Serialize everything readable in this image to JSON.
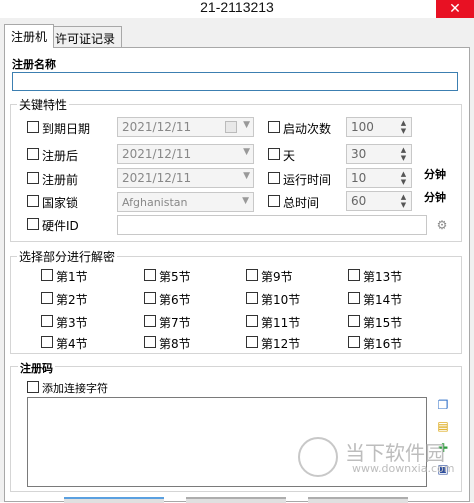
{
  "window": {
    "title": "21-2113213",
    "close_glyph": "✕"
  },
  "tabs": [
    {
      "label": "注册机",
      "active": true
    },
    {
      "label": "许可证记录",
      "active": false
    }
  ],
  "reg_name": {
    "label": "注册名称",
    "value": ""
  },
  "key_props": {
    "title": "关键特性",
    "expire_date": {
      "label": "到期日期",
      "value": "2021/12/11",
      "checked": false
    },
    "after_reg": {
      "label": "注册后",
      "value": "2021/12/11",
      "checked": false
    },
    "before_reg": {
      "label": "注册前",
      "value": "2021/12/11",
      "checked": false
    },
    "country_lock": {
      "label": "国家锁",
      "value": "Afghanistan",
      "checked": false
    },
    "hardware_id": {
      "label": "硬件ID",
      "value": "",
      "checked": false
    },
    "launch_count": {
      "label": "启动次数",
      "value": "100",
      "checked": false
    },
    "days": {
      "label": "天",
      "value": "30",
      "checked": false
    },
    "run_time": {
      "label": "运行时间",
      "value": "10",
      "unit": "分钟",
      "checked": false
    },
    "total_time": {
      "label": "总时间",
      "value": "60",
      "unit": "分钟",
      "checked": false
    }
  },
  "sections": {
    "title": "选择部分进行解密",
    "items": [
      "第1节",
      "第5节",
      "第9节",
      "第13节",
      "第2节",
      "第6节",
      "第10节",
      "第14节",
      "第3节",
      "第7节",
      "第11节",
      "第15节",
      "第4节",
      "第8节",
      "第12节",
      "第16节"
    ]
  },
  "reg_code": {
    "label": "注册码",
    "add_separator_label": "添加连接字符",
    "value": ""
  },
  "watermark": {
    "text": "当下软件园",
    "url": "www.downxia.com"
  },
  "accent_colors": {
    "close": "#e81123",
    "focus_border": "#3c7fb1"
  }
}
